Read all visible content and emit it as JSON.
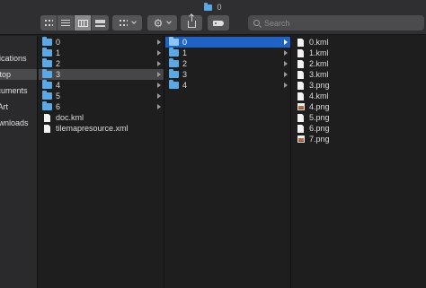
{
  "window": {
    "title": "0"
  },
  "toolbar": {
    "view_buttons": [
      "icon-view",
      "list-view",
      "column-view",
      "gallery-view"
    ],
    "active_view": "column-view",
    "search_placeholder": "Search"
  },
  "sidebar": {
    "items": [
      {
        "label": "Applications",
        "selected": false
      },
      {
        "label": "Desktop",
        "selected": true
      },
      {
        "label": "Documents",
        "selected": false
      },
      {
        "label": "CoralArt",
        "selected": false
      },
      {
        "label": "Downloads",
        "selected": false
      }
    ]
  },
  "columns": [
    {
      "items": [
        {
          "name": "0",
          "kind": "folder",
          "selected": false
        },
        {
          "name": "1",
          "kind": "folder",
          "selected": false
        },
        {
          "name": "2",
          "kind": "folder",
          "selected": false
        },
        {
          "name": "3",
          "kind": "folder",
          "selected": true
        },
        {
          "name": "4",
          "kind": "folder",
          "selected": false
        },
        {
          "name": "5",
          "kind": "folder",
          "selected": false
        },
        {
          "name": "6",
          "kind": "folder",
          "selected": false
        },
        {
          "name": "doc.kml",
          "kind": "file",
          "selected": false
        },
        {
          "name": "tilemapresource.xml",
          "kind": "file",
          "selected": false
        }
      ]
    },
    {
      "items": [
        {
          "name": "0",
          "kind": "folder",
          "selected": true
        },
        {
          "name": "1",
          "kind": "folder",
          "selected": false
        },
        {
          "name": "2",
          "kind": "folder",
          "selected": false
        },
        {
          "name": "3",
          "kind": "folder",
          "selected": false
        },
        {
          "name": "4",
          "kind": "folder",
          "selected": false
        }
      ]
    },
    {
      "items": [
        {
          "name": "0.kml",
          "kind": "file"
        },
        {
          "name": "1.kml",
          "kind": "file"
        },
        {
          "name": "2.kml",
          "kind": "file"
        },
        {
          "name": "3.kml",
          "kind": "file"
        },
        {
          "name": "3.png",
          "kind": "file"
        },
        {
          "name": "4.kml",
          "kind": "file"
        },
        {
          "name": "4.png",
          "kind": "image"
        },
        {
          "name": "5.png",
          "kind": "file"
        },
        {
          "name": "6.png",
          "kind": "file"
        },
        {
          "name": "7.png",
          "kind": "image"
        }
      ]
    }
  ],
  "colors": {
    "selection_blue": "#2063c6",
    "folder_blue": "#5aa9e6",
    "inactive_selection": "#464648"
  }
}
